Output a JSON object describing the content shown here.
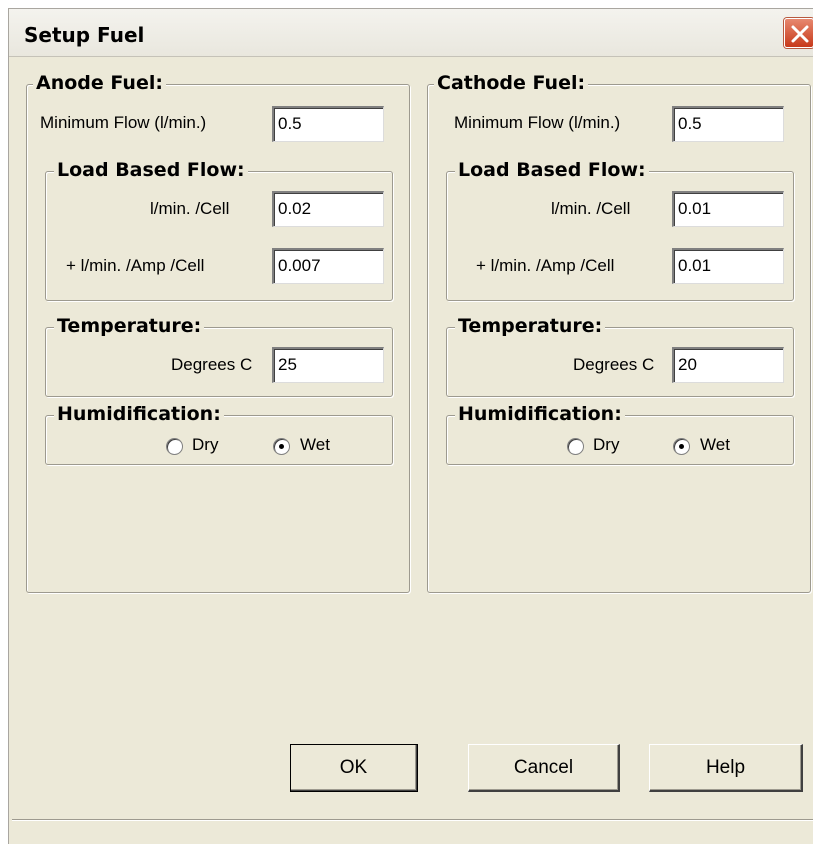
{
  "window": {
    "title": "Setup Fuel"
  },
  "anode": {
    "title": "Anode Fuel:",
    "min_flow_label": "Minimum Flow (l/min.)",
    "min_flow_value": "0.5",
    "load_title": "Load Based Flow:",
    "per_cell_label": "l/min. /Cell",
    "per_cell_value": "0.02",
    "per_amp_label": "+ l/min. /Amp /Cell",
    "per_amp_value": "0.007",
    "temp_title": "Temperature:",
    "temp_label": "Degrees C",
    "temp_value": "25",
    "humid_title": "Humidification:",
    "dry_label": "Dry",
    "wet_label": "Wet",
    "selected": "Wet"
  },
  "cathode": {
    "title": "Cathode Fuel:",
    "min_flow_label": "Minimum Flow (l/min.)",
    "min_flow_value": "0.5",
    "load_title": "Load Based Flow:",
    "per_cell_label": "l/min. /Cell",
    "per_cell_value": "0.01",
    "per_amp_label": "+ l/min. /Amp /Cell",
    "per_amp_value": "0.01",
    "temp_title": "Temperature:",
    "temp_label": "Degrees C",
    "temp_value": "20",
    "humid_title": "Humidification:",
    "dry_label": "Dry",
    "wet_label": "Wet",
    "selected": "Wet"
  },
  "buttons": {
    "ok": "OK",
    "cancel": "Cancel",
    "help": "Help"
  }
}
